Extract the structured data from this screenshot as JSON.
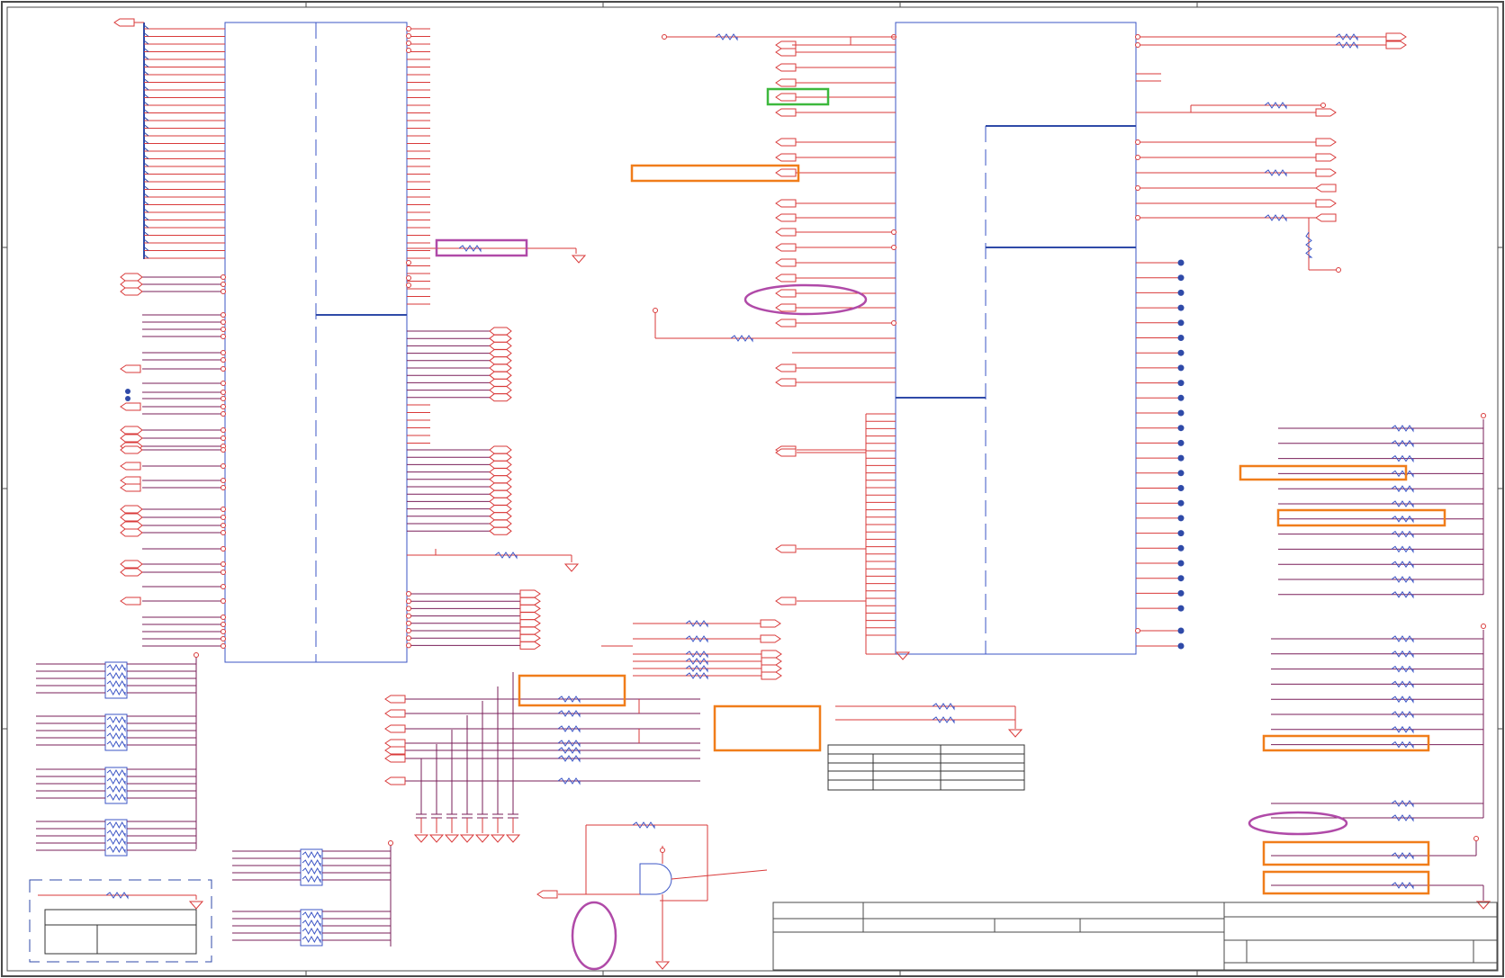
{
  "sheet": {
    "background": "#ffffff",
    "border_color": "#4a4a4a",
    "zone_ticks": [
      "",
      "",
      "",
      "",
      ""
    ],
    "title_block": {
      "title": "",
      "sheet_label": "",
      "revision": "",
      "company": ""
    }
  },
  "colors": {
    "wire": "#d93a3a",
    "bus": "#2f4aa8",
    "net_dark": "#7a1f5a",
    "component_outline": "#3b55c6",
    "resistor": "#3b55c6",
    "port_fill": "#ffffff",
    "highlight_orange": "#f07d1a",
    "highlight_purple": "#b04aa8",
    "highlight_green": "#3db83d",
    "junction": "#2f4aa8"
  },
  "highlights": [
    {
      "id": "orange-net-label-1",
      "color": "orange"
    },
    {
      "id": "orange-resistor-box",
      "color": "orange"
    },
    {
      "id": "orange-empty-box",
      "color": "orange"
    },
    {
      "id": "orange-right-1",
      "color": "orange"
    },
    {
      "id": "orange-right-2",
      "color": "orange"
    },
    {
      "id": "orange-right-3",
      "color": "orange"
    },
    {
      "id": "orange-right-4",
      "color": "orange"
    },
    {
      "id": "orange-right-5",
      "color": "orange"
    },
    {
      "id": "purple-resistor-box",
      "color": "purple"
    },
    {
      "id": "purple-ellipse-center",
      "color": "purple"
    },
    {
      "id": "purple-ellipse-right",
      "color": "purple"
    },
    {
      "id": "purple-ellipse-bottom",
      "color": "purple"
    },
    {
      "id": "green-port-box",
      "color": "green"
    }
  ],
  "icons": [
    "ground-symbol-icon",
    "resistor-icon",
    "resistor-network-icon",
    "and-gate-icon",
    "off-page-connector-icon",
    "junction-dot-icon",
    "power-pin-icon"
  ]
}
